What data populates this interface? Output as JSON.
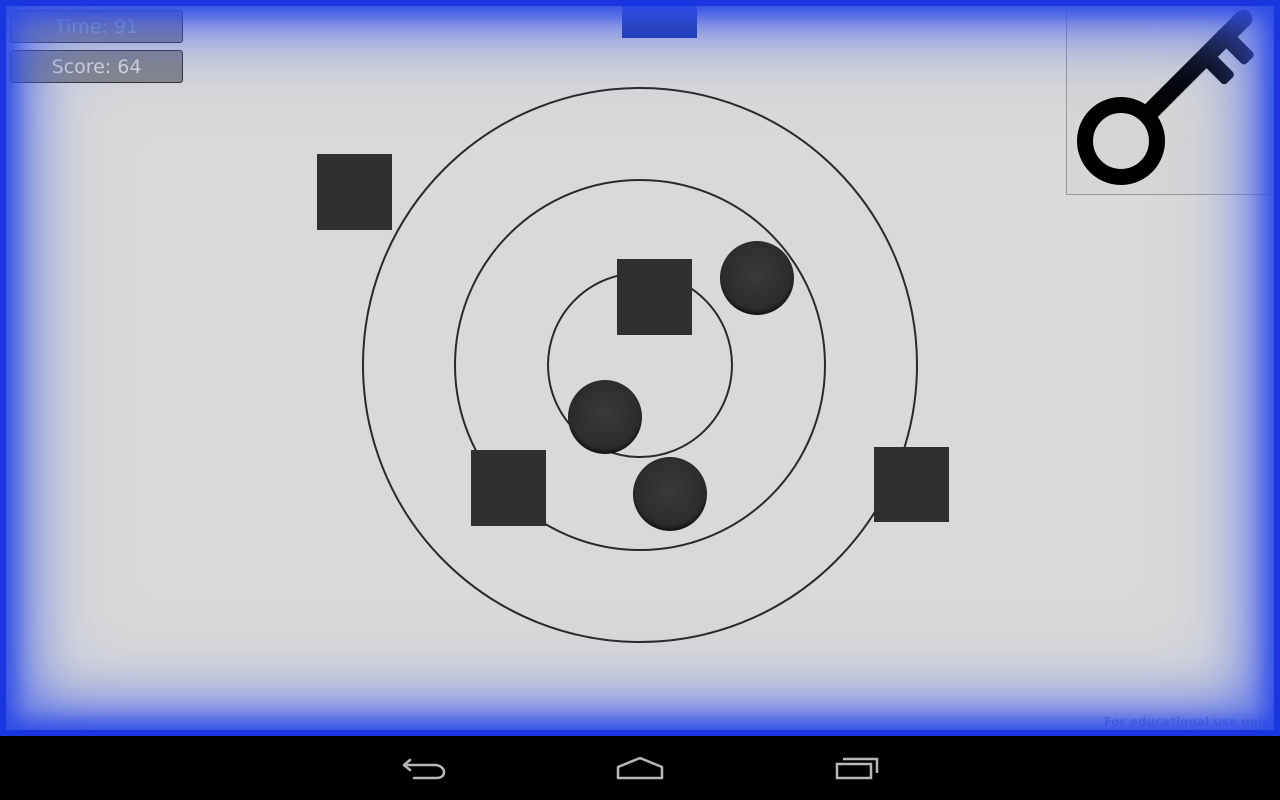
{
  "hud": {
    "time_label": "Time:",
    "time_value": "91",
    "score_label": "Score:",
    "score_value": "64"
  },
  "key_button": {
    "icon": "key-icon"
  },
  "watermark": "For educational use only",
  "navbar": {
    "back_icon": "back-icon",
    "home_icon": "home-icon",
    "recents_icon": "recent-apps-icon"
  },
  "colors": {
    "frame": "#1a36e0",
    "field": "#d9d9d9",
    "piece": "#2f2f2f",
    "top_tab": "#0e2a9a"
  }
}
